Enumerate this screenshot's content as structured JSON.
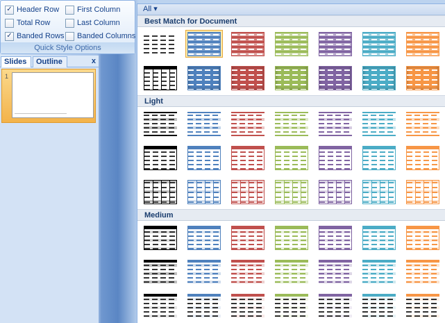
{
  "ribbon": {
    "options": [
      {
        "label": "Header Row",
        "checked": true
      },
      {
        "label": "First Column",
        "checked": false
      },
      {
        "label": "Total Row",
        "checked": false
      },
      {
        "label": "Last Column",
        "checked": false
      },
      {
        "label": "Banded Rows",
        "checked": true
      },
      {
        "label": "Banded Columns",
        "checked": false
      }
    ],
    "group_title": "Quick Style Options"
  },
  "pane": {
    "tab_slides": "Slides",
    "tab_outline": "Outline",
    "close": "x",
    "slide_number": "1"
  },
  "gallery": {
    "filter_label": "All ▾",
    "sections": [
      {
        "title": "Best Match for Document",
        "rows": [
          [
            "plain",
            "blue",
            "red",
            "green",
            "purple",
            "aqua",
            "orange"
          ],
          [
            "grid-white",
            "blue",
            "red",
            "green",
            "purple",
            "aqua",
            "orange"
          ]
        ]
      },
      {
        "title": "Light",
        "rows": [
          [
            "plain",
            "blue",
            "red",
            "green",
            "purple",
            "aqua",
            "orange"
          ],
          [
            "plain",
            "blue",
            "red",
            "green",
            "purple",
            "aqua",
            "orange"
          ],
          [
            "plain",
            "blue",
            "red",
            "green",
            "purple",
            "aqua",
            "orange"
          ]
        ]
      },
      {
        "title": "Medium",
        "rows": [
          [
            "plain",
            "blue",
            "red",
            "green",
            "purple",
            "aqua",
            "orange"
          ],
          [
            "plain",
            "blue",
            "red",
            "green",
            "purple",
            "aqua",
            "orange"
          ],
          [
            "plain",
            "blue",
            "red",
            "green",
            "purple",
            "aqua",
            "orange"
          ]
        ]
      }
    ],
    "selected": "Best Match for Document, row 1, blue",
    "colors": {
      "plain": "#000000",
      "blue": "#4f81bd",
      "red": "#c0504d",
      "green": "#9bbb59",
      "purple": "#8064a2",
      "aqua": "#4bacc6",
      "orange": "#f79646"
    }
  }
}
